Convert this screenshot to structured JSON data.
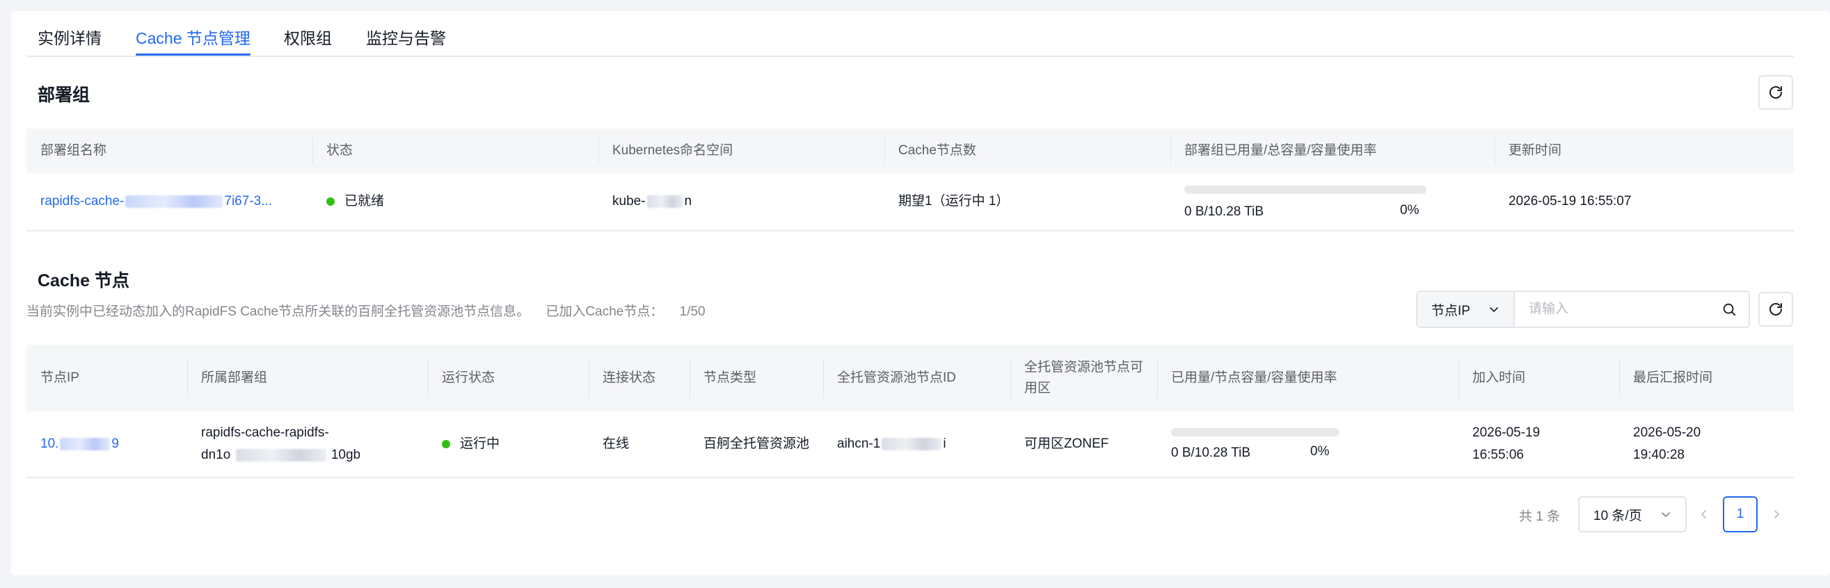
{
  "tabs": [
    {
      "label": "实例详情"
    },
    {
      "label": "Cache 节点管理"
    },
    {
      "label": "权限组"
    },
    {
      "label": "监控与告警"
    }
  ],
  "deploy_group": {
    "title": "部署组",
    "headers": [
      "部署组名称",
      "状态",
      "Kubernetes命名空间",
      "Cache节点数",
      "部署组已用量/总容量/容量使用率",
      "更新时间"
    ],
    "row": {
      "name_prefix": "rapidfs-cache-",
      "name_suffix": "7i67-3...",
      "status": "已就绪",
      "namespace_prefix": "kube-",
      "namespace_suffix": "n",
      "node_count": "期望1（运行中 1）",
      "usage_label": "0 B/10.28 TiB",
      "usage_percent": "0%",
      "usage_fraction": 0,
      "updated": "2026-05-19 16:55:07"
    }
  },
  "cache_nodes": {
    "title": "Cache 节点",
    "description": "当前实例中已经动态加入的RapidFS Cache节点所关联的百舸全托管资源池节点信息。",
    "joined_label": "已加入Cache节点：",
    "joined_value": "1/50",
    "filter_select": "节点IP",
    "filter_placeholder": "请输入",
    "headers": [
      "节点IP",
      "所属部署组",
      "运行状态",
      "连接状态",
      "节点类型",
      "全托管资源池节点ID",
      "全托管资源池节点可用区",
      "已用量/节点容量/容量使用率",
      "加入时间",
      "最后汇报时间"
    ],
    "row": {
      "ip_prefix": "10.",
      "ip_suffix": "9",
      "group_line1": "rapidfs-cache-rapidfs-",
      "group_line2_prefix": "dn1o",
      "group_line2_suffix": "10gb",
      "run_status": "运行中",
      "conn_status": "在线",
      "node_type": "百舸全托管资源池",
      "pool_node_id_prefix": "aihcn-1",
      "pool_node_id_suffix": "i",
      "zone": "可用区ZONEF",
      "usage_label": "0 B/10.28 TiB",
      "usage_percent": "0%",
      "usage_fraction": 0,
      "join_date": "2026-05-19",
      "join_time": "16:55:06",
      "report_date": "2026-05-20",
      "report_time": "19:40:28"
    }
  },
  "pagination": {
    "total": "共 1 条",
    "page_size": "10 条/页",
    "current_page": "1"
  },
  "icons": {
    "refresh": "refresh-icon",
    "search": "search-icon",
    "chevron_down": "chevron-down-icon",
    "chevron_left": "chevron-left-icon",
    "chevron_right": "chevron-right-icon"
  },
  "colors": {
    "accent": "#2468f2",
    "status_ok": "#30bf13"
  }
}
